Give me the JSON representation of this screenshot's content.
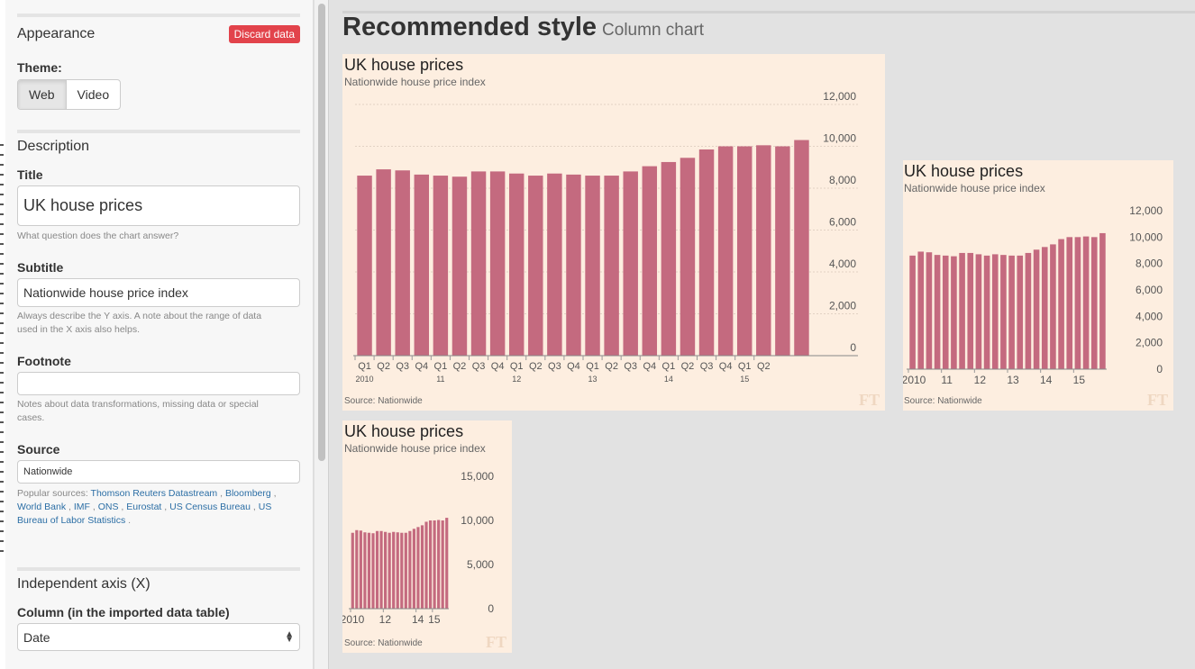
{
  "sidebar": {
    "appearance": {
      "title": "Appearance",
      "discard_label": "Discard data"
    },
    "theme": {
      "label": "Theme:",
      "options": [
        "Web",
        "Video"
      ],
      "selected": "Web"
    },
    "description": {
      "title": "Description",
      "title_label": "Title",
      "title_value": "UK house prices",
      "title_help": "What question does the chart answer?",
      "subtitle_label": "Subtitle",
      "subtitle_value": "Nationwide house price index",
      "subtitle_help_1": "Always describe the Y axis. A note about the range of data",
      "subtitle_help_2": "used in the X axis also helps.",
      "footnote_label": "Footnote",
      "footnote_value": "",
      "footnote_help_1": "Notes about data transformations, missing data or special",
      "footnote_help_2": "cases.",
      "source_label": "Source",
      "source_value": "Nationwide",
      "popular_prefix": "Popular sources:",
      "popular_sources": [
        "Thomson Reuters Datastream",
        "Bloomberg",
        "World Bank",
        "IMF",
        "ONS",
        "Eurostat",
        "US Census Bureau",
        "US Bureau of Labor Statistics"
      ]
    },
    "x_axis": {
      "title": "Independent axis (X)",
      "column_label": "Column (in the imported data table)",
      "column_value": "Date"
    }
  },
  "main": {
    "heading": "Recommended style",
    "heading_sub": "Column chart"
  },
  "colors": {
    "bar": "#c46a7f",
    "card_bg": "#fdeee0",
    "discard": "#e2434b",
    "link": "#2b6ea5"
  },
  "chart_data": [
    {
      "type": "bar",
      "title": "UK house prices",
      "subtitle": "Nationwide house price index",
      "source": "Source: Nationwide",
      "logo": "FT",
      "categories": [
        "Q1",
        "Q2",
        "Q3",
        "Q4",
        "Q1",
        "Q2",
        "Q3",
        "Q4",
        "Q1",
        "Q2",
        "Q3",
        "Q4",
        "Q1",
        "Q2",
        "Q3",
        "Q4",
        "Q1",
        "Q2",
        "Q3",
        "Q4",
        "Q1",
        "Q2"
      ],
      "year_labels": [
        "2010",
        "",
        "",
        "",
        "11",
        "",
        "",
        "",
        "12",
        "",
        "",
        "",
        "13",
        "",
        "",
        "",
        "14",
        "",
        "",
        "",
        "15",
        ""
      ],
      "values": [
        8600,
        8900,
        8850,
        8650,
        8600,
        8550,
        8800,
        8800,
        8700,
        8600,
        8700,
        8650,
        8600,
        8600,
        8800,
        9050,
        9250,
        9450,
        9850,
        10000,
        10000,
        10050,
        10000,
        10300
      ],
      "ylim": [
        0,
        12000
      ],
      "yticks": [
        "0",
        "2,000",
        "4,000",
        "6,000",
        "8,000",
        "10,000",
        "12,000"
      ],
      "grid": true
    },
    {
      "type": "bar",
      "title": "UK house prices",
      "subtitle": "Nationwide house price index",
      "source": "Source: Nationwide",
      "logo": "FT",
      "year_labels": [
        "2010",
        "11",
        "12",
        "13",
        "14",
        "15"
      ],
      "values": [
        8600,
        8900,
        8850,
        8650,
        8600,
        8550,
        8800,
        8800,
        8700,
        8600,
        8700,
        8650,
        8600,
        8600,
        8800,
        9050,
        9250,
        9450,
        9850,
        10000,
        10000,
        10050,
        10000,
        10300
      ],
      "ylim": [
        0,
        12000
      ],
      "yticks": [
        "0",
        "2,000",
        "4,000",
        "6,000",
        "8,000",
        "10,000",
        "12,000"
      ],
      "grid": false
    },
    {
      "type": "bar",
      "title": "UK house prices",
      "subtitle": "Nationwide house price index",
      "source": "Source: Nationwide",
      "logo": "FT",
      "year_labels": [
        "2010",
        "12",
        "14",
        "15"
      ],
      "values": [
        8600,
        8900,
        8850,
        8650,
        8600,
        8550,
        8800,
        8800,
        8700,
        8600,
        8700,
        8650,
        8600,
        8600,
        8800,
        9050,
        9250,
        9450,
        9850,
        10000,
        10000,
        10050,
        10000,
        10300
      ],
      "ylim": [
        0,
        15000
      ],
      "yticks": [
        "0",
        "5,000",
        "10,000",
        "15,000"
      ],
      "grid": false
    }
  ]
}
